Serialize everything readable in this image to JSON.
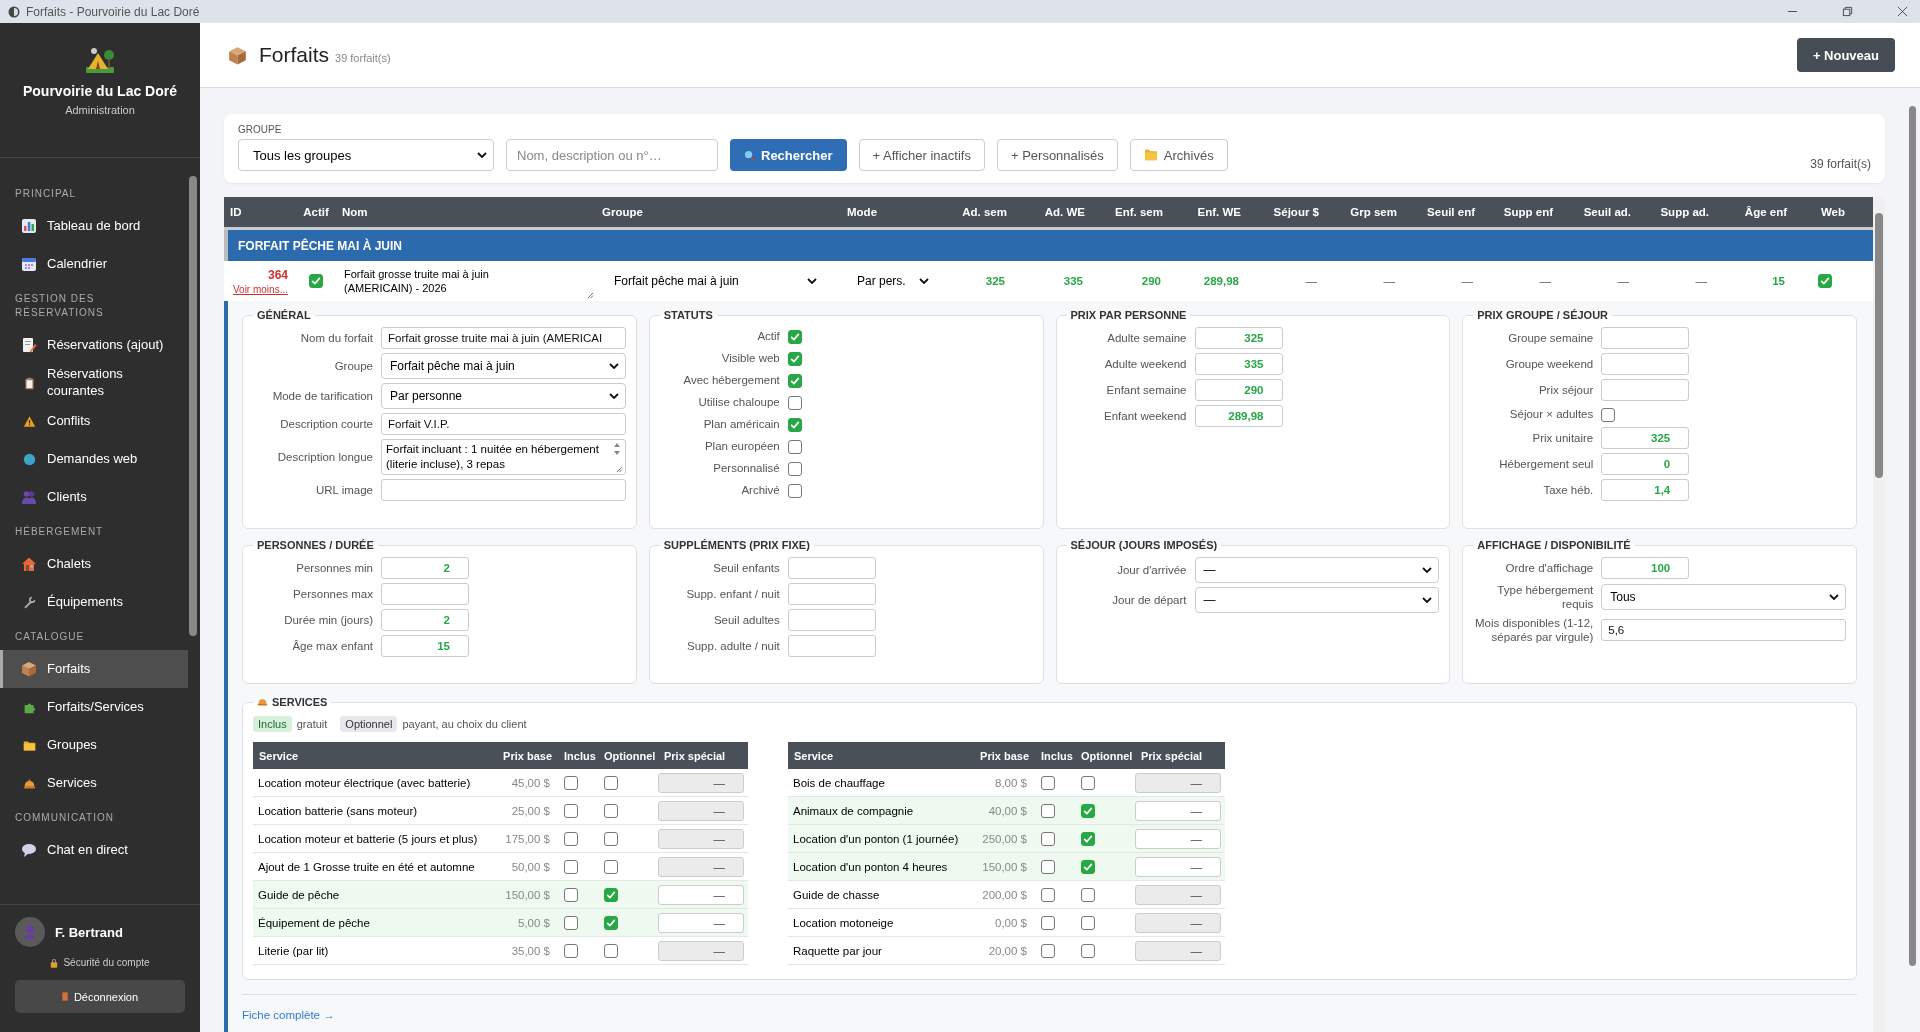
{
  "window": {
    "title": "Forfaits - Pourvoirie du Lac Doré"
  },
  "sidebar": {
    "brand": {
      "name": "Pourvoirie du Lac Doré",
      "subtitle": "Administration"
    },
    "sections": [
      {
        "title": "PRINCIPAL",
        "items": [
          {
            "label": "Tableau de bord",
            "selected": false
          },
          {
            "label": "Calendrier",
            "selected": false
          }
        ]
      },
      {
        "title": "GESTION DES RÉSERVATIONS",
        "items": [
          {
            "label": "Réservations (ajout)",
            "selected": false
          },
          {
            "label": "Réservations courantes",
            "selected": false
          },
          {
            "label": "Conflits",
            "selected": false
          },
          {
            "label": "Demandes web",
            "selected": false
          },
          {
            "label": "Clients",
            "selected": false
          }
        ]
      },
      {
        "title": "HÉBERGEMENT",
        "items": [
          {
            "label": "Chalets",
            "selected": false
          },
          {
            "label": "Équipements",
            "selected": false
          }
        ]
      },
      {
        "title": "CATALOGUE",
        "items": [
          {
            "label": "Forfaits",
            "selected": true
          },
          {
            "label": "Forfaits/Services",
            "selected": false
          },
          {
            "label": "Groupes",
            "selected": false
          },
          {
            "label": "Services",
            "selected": false
          }
        ]
      },
      {
        "title": "COMMUNICATION",
        "items": [
          {
            "label": "Chat en direct",
            "selected": false
          }
        ]
      }
    ],
    "user": {
      "name": "F. Bertrand",
      "security_link": "Sécurité du compte"
    },
    "logout": "Déconnexion"
  },
  "header": {
    "title": "Forfaits",
    "count": "39 forfait(s)",
    "new_button": "+ Nouveau"
  },
  "filters": {
    "group_label": "GROUPE",
    "group_value": "Tous les groupes",
    "search_placeholder": "Nom, description ou n°…",
    "search_button": "Rechercher",
    "buttons": [
      "+ Afficher inactifs",
      "+ Personnalisés",
      "Archivés"
    ],
    "count": "39 forfait(s)"
  },
  "table": {
    "columns": [
      "ID",
      "Actif",
      "Nom",
      "Groupe",
      "Mode",
      "Ad. sem",
      "Ad. WE",
      "Enf. sem",
      "Enf. WE",
      "Séjour $",
      "Grp sem",
      "Seuil enf",
      "Supp enf",
      "Seuil ad.",
      "Supp ad.",
      "Âge enf",
      "Web"
    ],
    "group_row": "FORFAIT PÊCHE MAI À JUIN",
    "row": {
      "id": "364",
      "toggle_link": "Voir moins...",
      "actif": true,
      "nom": "Forfait grosse truite mai à juin (AMERICAIN) - 2026",
      "groupe": "Forfait pêche mai à juin",
      "mode": "Par pers.",
      "values": [
        {
          "text": "325",
          "kind": "number"
        },
        {
          "text": "335",
          "kind": "number"
        },
        {
          "text": "290",
          "kind": "number"
        },
        {
          "text": "289,98",
          "kind": "number"
        },
        {
          "text": "—",
          "kind": "empty"
        },
        {
          "text": "—",
          "kind": "empty"
        },
        {
          "text": "—",
          "kind": "empty"
        },
        {
          "text": "—",
          "kind": "empty"
        },
        {
          "text": "—",
          "kind": "empty"
        },
        {
          "text": "—",
          "kind": "empty"
        },
        {
          "text": "15",
          "kind": "number"
        }
      ],
      "web": true
    }
  },
  "detail": {
    "sections": [
      {
        "title": "GÉNÉRAL",
        "fields": [
          {
            "label": "Nom du forfait",
            "kind": "text",
            "value": "Forfait grosse truite mai à juin (AMERICAI"
          },
          {
            "label": "Groupe",
            "kind": "select",
            "value": "Forfait pêche mai à juin"
          },
          {
            "label": "Mode de tarification",
            "kind": "select",
            "value": "Par personne"
          },
          {
            "label": "Description courte",
            "kind": "text",
            "value": "Forfait V.I.P."
          },
          {
            "label": "Description longue",
            "kind": "textarea",
            "value": "Forfait incluant : 1 nuitée en hébergement (literie incluse), 3 repas"
          },
          {
            "label": "URL image",
            "kind": "text"
          }
        ]
      },
      {
        "title": "STATUTS",
        "fields": [
          {
            "label": "Actif",
            "kind": "checkbox",
            "checked": true
          },
          {
            "label": "Visible web",
            "kind": "checkbox",
            "checked": true
          },
          {
            "label": "Avec hébergement",
            "kind": "checkbox",
            "checked": true
          },
          {
            "label": "Utilise chaloupe",
            "kind": "checkbox",
            "checked": false
          },
          {
            "label": "Plan américain",
            "kind": "checkbox",
            "checked": true
          },
          {
            "label": "Plan européen",
            "kind": "checkbox",
            "checked": false
          },
          {
            "label": "Personnalisé",
            "kind": "checkbox",
            "checked": false
          },
          {
            "label": "Archivé",
            "kind": "checkbox",
            "checked": false
          }
        ]
      },
      {
        "title": "PRIX PAR PERSONNE",
        "fields": [
          {
            "label": "Adulte semaine",
            "kind": "number",
            "value": "325"
          },
          {
            "label": "Adulte weekend",
            "kind": "number",
            "value": "335"
          },
          {
            "label": "Enfant semaine",
            "kind": "number",
            "value": "290"
          },
          {
            "label": "Enfant weekend",
            "kind": "number",
            "value": "289,98"
          }
        ]
      },
      {
        "title": "PRIX GROUPE / SÉJOUR",
        "fields": [
          {
            "label": "Groupe semaine",
            "kind": "number"
          },
          {
            "label": "Groupe weekend",
            "kind": "number"
          },
          {
            "label": "Prix séjour",
            "kind": "number"
          },
          {
            "label": "Séjour × adultes",
            "kind": "checkbox",
            "checked": false
          },
          {
            "label": "Prix unitaire",
            "kind": "number",
            "value": "325"
          },
          {
            "label": "Hébergement seul",
            "kind": "number",
            "value": "0"
          },
          {
            "label": "Taxe héb.",
            "kind": "number",
            "value": "1,4"
          }
        ]
      },
      {
        "title": "PERSONNES / DURÉE",
        "fields": [
          {
            "label": "Personnes min",
            "kind": "number",
            "value": "2"
          },
          {
            "label": "Personnes max",
            "kind": "number"
          },
          {
            "label": "Durée min (jours)",
            "kind": "number",
            "value": "2"
          },
          {
            "label": "Âge max enfant",
            "kind": "number",
            "value": "15"
          }
        ]
      },
      {
        "title": "SUPPLÉMENTS (PRIX FIXE)",
        "fields": [
          {
            "label": "Seuil enfants",
            "kind": "number"
          },
          {
            "label": "Supp. enfant / nuit",
            "kind": "number"
          },
          {
            "label": "Seuil adultes",
            "kind": "number"
          },
          {
            "label": "Supp. adulte / nuit",
            "kind": "number"
          }
        ]
      },
      {
        "title": "SÉJOUR (JOURS IMPOSÉS)",
        "fields": [
          {
            "label": "Jour d'arrivée",
            "kind": "select",
            "value": "—"
          },
          {
            "label": "Jour de départ",
            "kind": "select",
            "value": "—"
          }
        ]
      },
      {
        "title": "AFFICHAGE / DISPONIBILITÉ",
        "fields": [
          {
            "label": "Ordre d'affichage",
            "kind": "number",
            "value": "100"
          },
          {
            "label": "Type hébergement requis",
            "kind": "select",
            "value": "Tous"
          },
          {
            "label": "Mois disponibles (1-12, séparés par virgule)",
            "kind": "text",
            "value": "5,6"
          }
        ]
      }
    ],
    "services": {
      "title": "SERVICES",
      "legend": [
        {
          "tag": "Inclus",
          "text": "gratuit",
          "kind": "included"
        },
        {
          "tag": "Optionnel",
          "text": "payant, au choix du client",
          "kind": "optional"
        }
      ],
      "tables": [
        {
          "columns": [
            "Service",
            "Prix base",
            "Inclus",
            "Optionnel",
            "Prix spécial"
          ],
          "rows": [
            {
              "service": "Location moteur électrique (avec batterie)",
              "price": "45,00 $",
              "included": false,
              "optional": false,
              "special": "—"
            },
            {
              "service": "Location batterie (sans moteur)",
              "price": "25,00 $",
              "included": false,
              "optional": false,
              "special": "—"
            },
            {
              "service": "Location moteur et batterie (5 jours et plus)",
              "price": "175,00 $",
              "included": false,
              "optional": false,
              "special": "—"
            },
            {
              "service": "Ajout de 1 Grosse truite en été et automne",
              "price": "50,00 $",
              "included": false,
              "optional": false,
              "special": "—"
            },
            {
              "service": "Guide de pêche",
              "price": "150,00 $",
              "included": false,
              "optional": true,
              "special": "—"
            },
            {
              "service": "Équipement de pêche",
              "price": "5,00 $",
              "included": false,
              "optional": true,
              "special": "—"
            },
            {
              "service": "Literie (par lit)",
              "price": "35,00 $",
              "included": false,
              "optional": false,
              "special": "—"
            }
          ]
        },
        {
          "columns": [
            "Service",
            "Prix base",
            "Inclus",
            "Optionnel",
            "Prix spécial"
          ],
          "rows": [
            {
              "service": "Bois de chauffage",
              "price": "8,00 $",
              "included": false,
              "optional": false,
              "special": "—"
            },
            {
              "service": "Animaux de compagnie",
              "price": "40,00 $",
              "included": false,
              "optional": true,
              "special": "—"
            },
            {
              "service": "Location d'un ponton (1 journée)",
              "price": "250,00 $",
              "included": false,
              "optional": true,
              "special": "—"
            },
            {
              "service": "Location d'un ponton 4 heures",
              "price": "150,00 $",
              "included": false,
              "optional": true,
              "special": "—"
            },
            {
              "service": "Guide de chasse",
              "price": "200,00 $",
              "included": false,
              "optional": false,
              "special": "—"
            },
            {
              "service": "Location motoneige",
              "price": "0,00 $",
              "included": false,
              "optional": false,
              "special": "—"
            },
            {
              "service": "Raquette par jour",
              "price": "20,00 $",
              "included": false,
              "optional": false,
              "special": "—"
            }
          ]
        }
      ]
    },
    "full_link": "Fiche complète →"
  }
}
